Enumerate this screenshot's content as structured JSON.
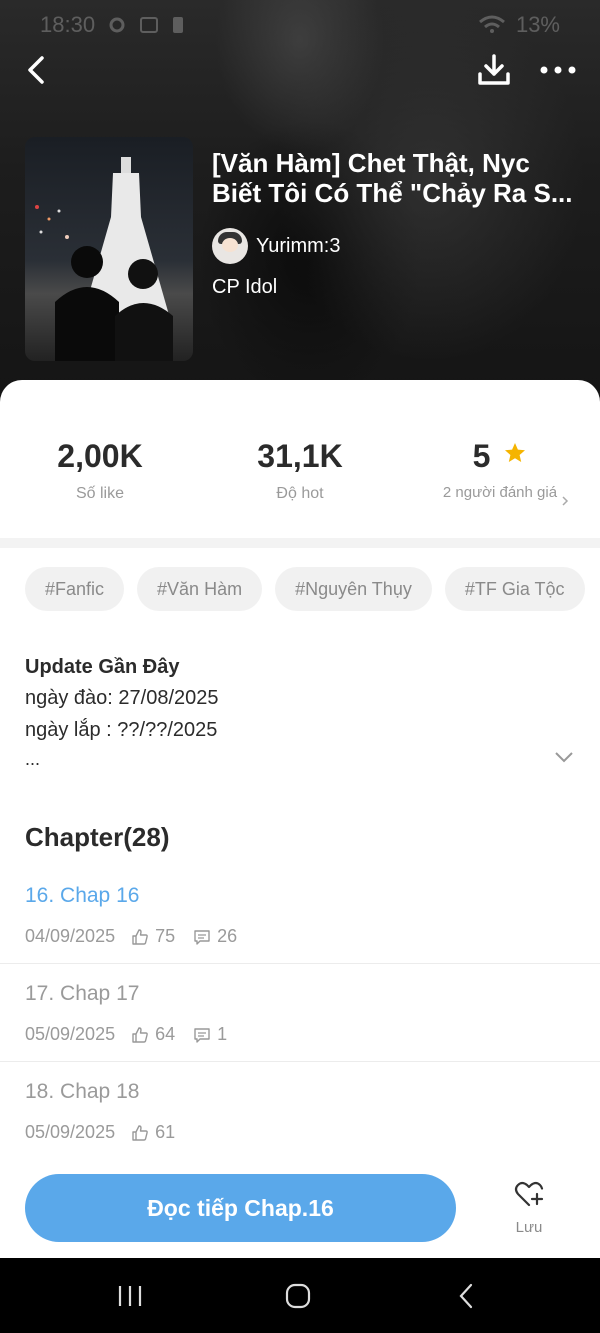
{
  "status_bar": {
    "time": "18:30",
    "battery": "13%"
  },
  "story": {
    "title_line1": "[Văn Hàm] Chet Thật, Nyc",
    "title_line2": "Biết Tôi Có Thể \"Chảy Ra S...",
    "author": "Yurimm:3",
    "category": "CP Idol"
  },
  "stats": [
    {
      "value": "2,00K",
      "label": "Số like"
    },
    {
      "value": "31,1K",
      "label": "Độ hot"
    },
    {
      "value": "5",
      "label": "2 người đánh giá"
    }
  ],
  "tags": [
    "#Fanfic",
    "#Văn Hàm",
    "#Nguyên Thụy",
    "#TF Gia Tộc"
  ],
  "update": {
    "heading": "Update Gần Đây",
    "line1": "ngày đào: 27/08/2025",
    "line2": "ngày lắp : ??/??/2025",
    "line3": "..."
  },
  "chapters_heading": "Chapter(28)",
  "chapters": [
    {
      "name": "16. Chap 16",
      "date": "04/09/2025",
      "likes": "75",
      "comments": "26"
    },
    {
      "name": "17. Chap 17",
      "date": "05/09/2025",
      "likes": "64",
      "comments": "1"
    },
    {
      "name": "18. Chap 18",
      "date": "05/09/2025",
      "likes": "61",
      "comments": ""
    }
  ],
  "cta_label": "Đọc tiếp Chap.16",
  "save_label": "Lưu",
  "colors": {
    "accent": "#5aa8ea",
    "star": "#f5b400"
  },
  "icons": [
    "back-icon",
    "download-icon",
    "more-icon",
    "star-icon",
    "chevron-right-icon",
    "chevron-down-icon",
    "like-icon",
    "comment-icon",
    "heart-plus-icon"
  ]
}
